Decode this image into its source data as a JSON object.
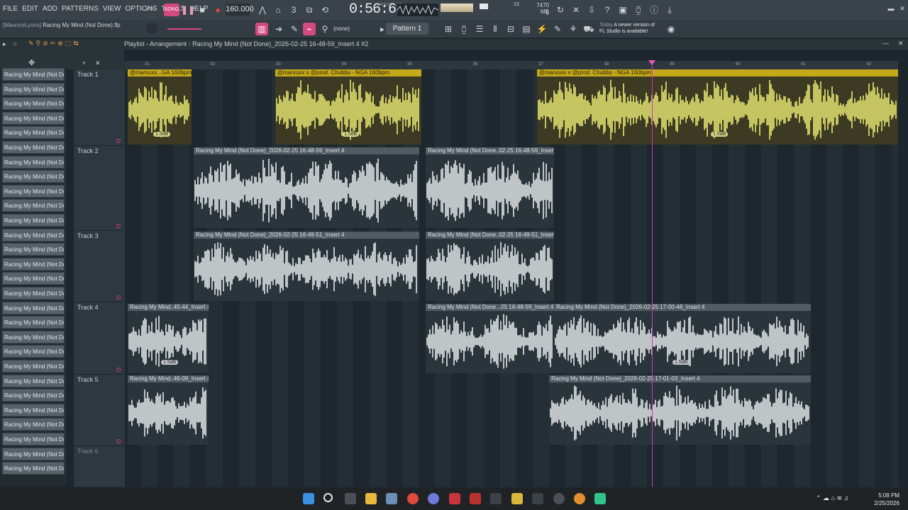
{
  "menu": [
    "FILE",
    "EDIT",
    "ADD",
    "PATTERNS",
    "VIEW",
    "OPTIONS",
    "TOOLS",
    "HELP"
  ],
  "transport": {
    "tempo": "160.000",
    "time": "0:56:63",
    "time_unit": "M:S:CS",
    "memory": "7470 MB",
    "cpu": "23",
    "voices": "5"
  },
  "project": {
    "user": "[MauriceLyons]",
    "file": "Racing My Mind (Not Done).flp"
  },
  "toolbar2": {
    "snap": "(none)",
    "pattern": "Pattern 1"
  },
  "news": {
    "today": "Today",
    "line1": "A newer version of",
    "line2": "FL Studio is available!"
  },
  "playlist": {
    "title": "Playlist - Arrangement",
    "breadcrumb": "Racing My Mind (Not Done)_2026-02-25 16-48-59_Insert 4 #2"
  },
  "ruler": [
    "31",
    "32",
    "33",
    "34",
    "35",
    "36",
    "37",
    "38",
    "39",
    "40",
    "41",
    "42"
  ],
  "picker": {
    "item_label": "Racing My Mind (Not Don...",
    "count": 28
  },
  "tracks": [
    {
      "name": "Track 1"
    },
    {
      "name": "Track 2"
    },
    {
      "name": "Track 3"
    },
    {
      "name": "Track 4"
    },
    {
      "name": "Track 5"
    },
    {
      "name": "Track 6"
    }
  ],
  "clips": {
    "t1a": "@marvuxx...GA 160bpm",
    "t1b": "@marvuxx x @prod. Chubbs - NGA 160bpm",
    "t1c": "@marvuxx x @prod. Chubbs - NGA 160bpm",
    "t2a": "Racing My Mind (Not Done)_2026-02-25 16-48-59_Insert 4",
    "t2b": "Racing My Mind (Not Done..02-25 16-48-59_Insert 4",
    "t3a": "Racing My Mind (Not Done)_2026-02-25 16-49-51_Insert 4",
    "t3b": "Racing My Mind (Not Done..02-25 16-49-51_Insert 4",
    "t4a": "Racing My Mind..45-44_Insert 4",
    "t4b": "Racing My Mind (Not Done..-25 16-48-59_Insert 4",
    "t4c": "Racing My Mind (Not Done)_2026-02-25 17-00-46_Insert 4",
    "t5a": "Racing My Mind..46-09_Insert 4",
    "t5b": "Racing My Mind (Not Done)_2026-02-25 17-01-03_Insert 4",
    "vol": "1.5dB"
  },
  "clock": {
    "time": "5:08 PM",
    "date": "2/25/2026"
  },
  "colors": {
    "accent": "#c43dba",
    "audio_yellow": "#e8e873",
    "audio_gray": "#e5e8ea"
  }
}
